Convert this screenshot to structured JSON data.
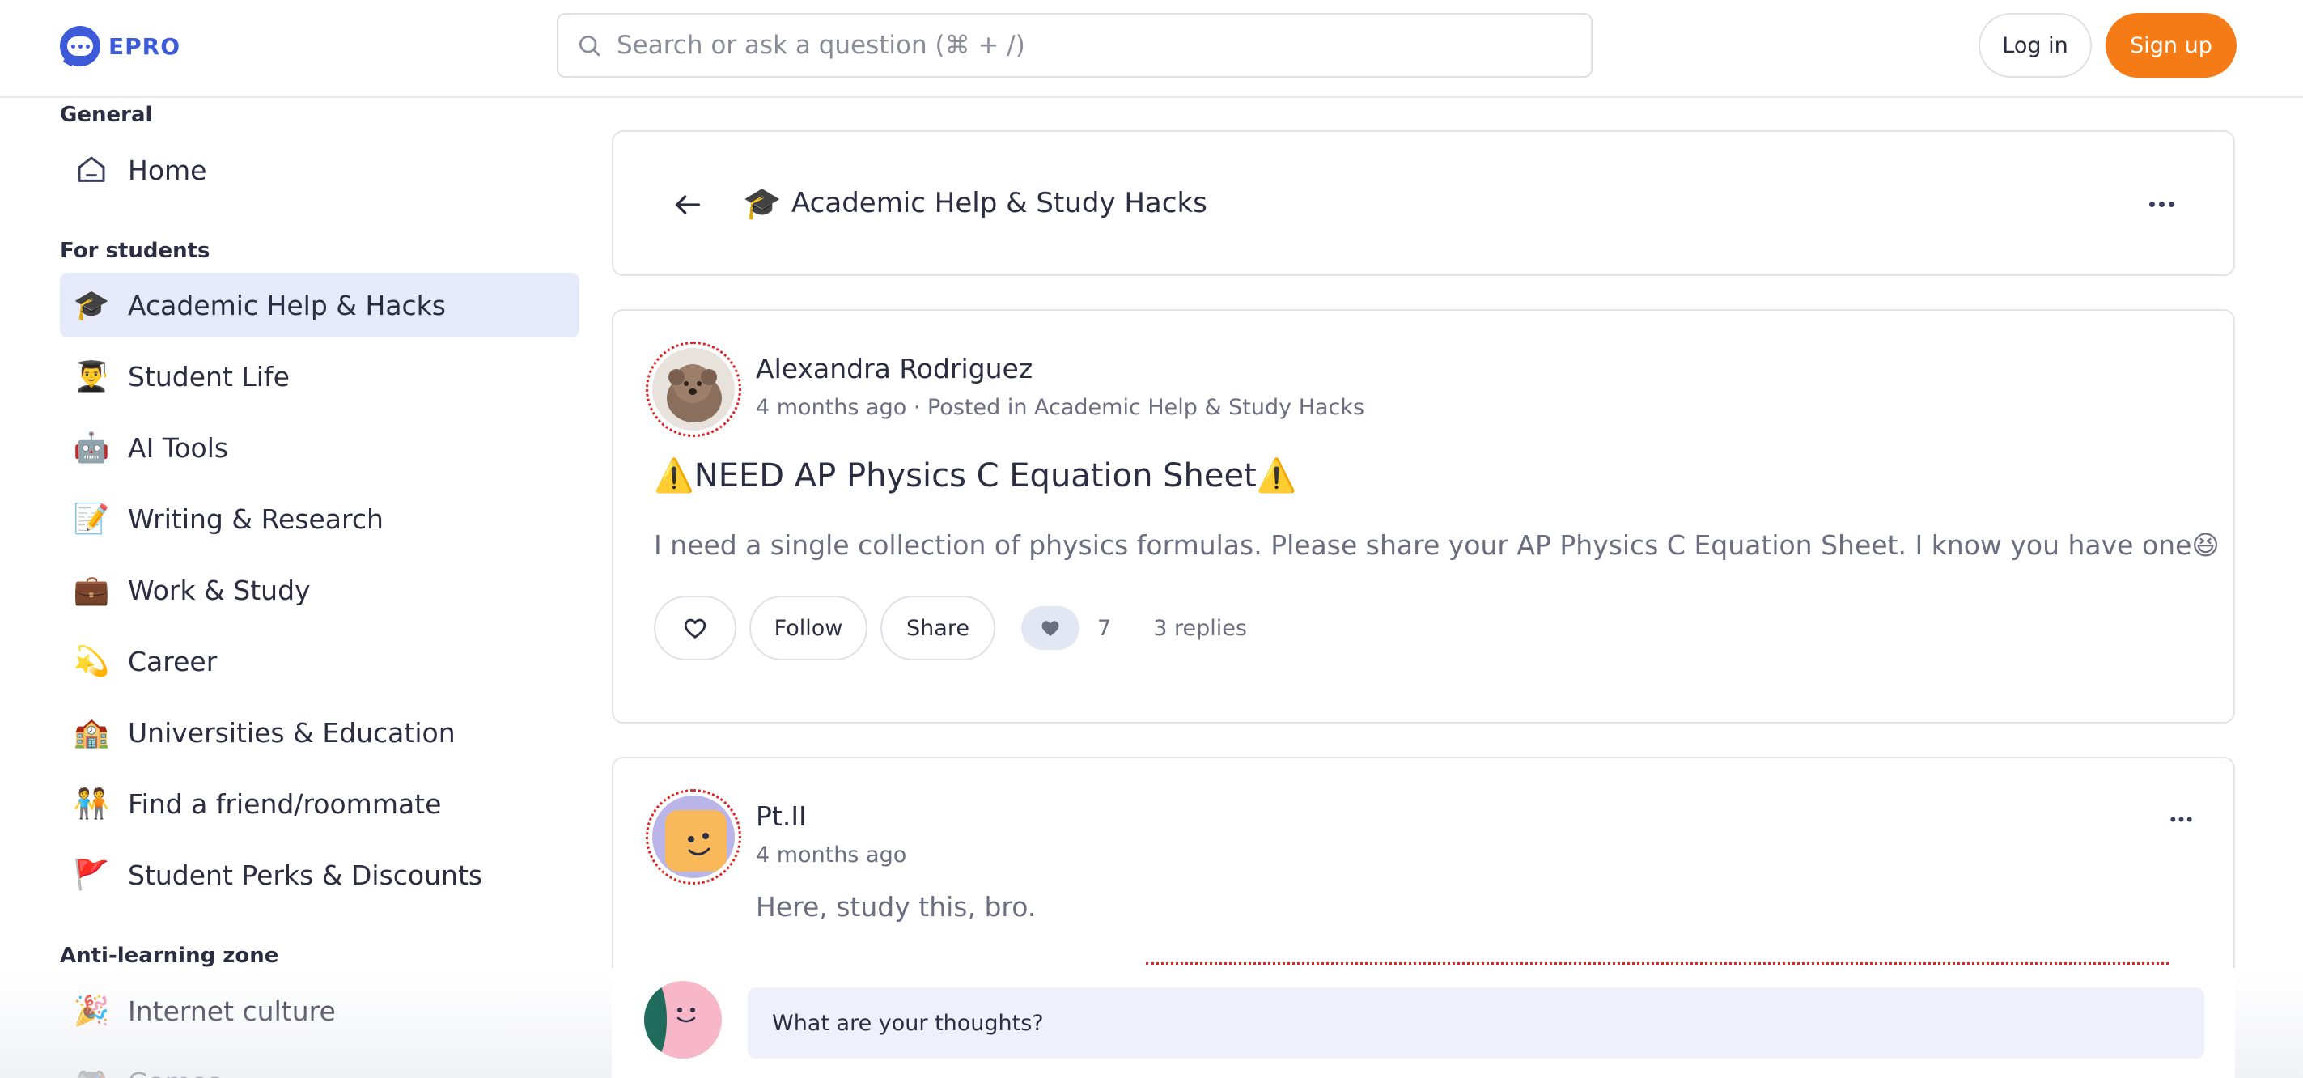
{
  "brand": {
    "name": "EPRO"
  },
  "search": {
    "placeholder": "Search or ask a question (⌘ + /)"
  },
  "auth": {
    "login_label": "Log in",
    "signup_label": "Sign up"
  },
  "sidebar": {
    "sections": [
      {
        "title": "General"
      },
      {
        "title": "For students"
      },
      {
        "title": "Anti-learning zone"
      }
    ],
    "items": [
      {
        "label": "Home",
        "icon": "home-icon"
      },
      {
        "label": "Academic Help & Hacks",
        "icon": "graduation-cap-icon",
        "emoji": "🎓",
        "active": true
      },
      {
        "label": "Student Life",
        "icon": "student-icon",
        "emoji": "👨‍🎓"
      },
      {
        "label": "AI Tools",
        "icon": "robot-icon",
        "emoji": "🤖"
      },
      {
        "label": "Writing & Research",
        "icon": "memo-icon",
        "emoji": "📝"
      },
      {
        "label": "Work & Study",
        "icon": "briefcase-icon",
        "emoji": "💼"
      },
      {
        "label": "Career",
        "icon": "dizzy-star-icon",
        "emoji": "💫"
      },
      {
        "label": "Universities & Education",
        "icon": "school-icon",
        "emoji": "🏫"
      },
      {
        "label": "Find a friend/roommate",
        "icon": "people-holding-hands-icon",
        "emoji": "🧑‍🤝‍🧑"
      },
      {
        "label": "Student Perks & Discounts",
        "icon": "flag-icon",
        "emoji": "🚩"
      },
      {
        "label": "Internet culture",
        "icon": "party-popper-icon",
        "emoji": "🎉"
      },
      {
        "label": "Games",
        "icon": "game-controller-icon",
        "emoji": "🎮"
      }
    ]
  },
  "topic_header": {
    "emoji": "🎓",
    "title": "Academic Help & Study Hacks"
  },
  "post": {
    "author": "Alexandra Rodriguez",
    "meta": "4 months ago · Posted in Academic Help & Study Hacks",
    "title": "⚠️NEED AP Physics C Equation Sheet⚠️",
    "body": "I need a single collection of physics formulas. Please share your AP Physics C Equation Sheet. I know you have one😆",
    "follow_label": "Follow",
    "share_label": "Share",
    "reaction_count": "7",
    "replies_label": "3 replies"
  },
  "reply": {
    "author": "Pt.II",
    "meta": "4 months ago",
    "body": "Here, study this, bro."
  },
  "composer": {
    "placeholder": "What are your thoughts?"
  },
  "colors": {
    "accent": "#3d5bd9",
    "signup": "#f47b16",
    "active_nav": "#e6e9f9",
    "dotted_ring": "#e02424"
  }
}
